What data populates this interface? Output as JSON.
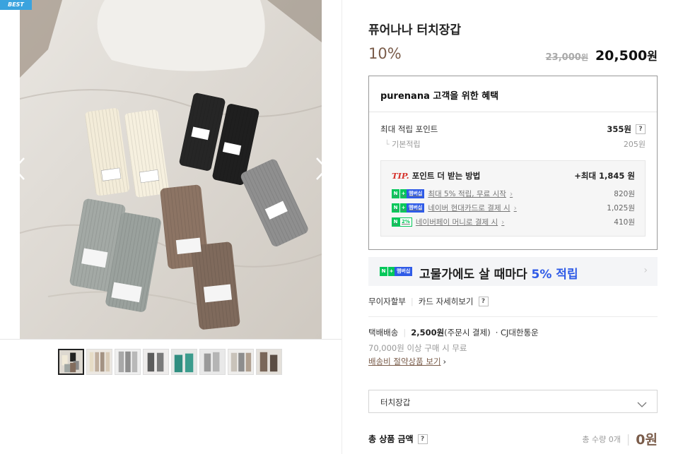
{
  "gallery": {
    "badge": "BEST",
    "thumb_count": 8
  },
  "product": {
    "title": "퓨어나나 터치장갑",
    "discount": "10%",
    "original_price": "23,000",
    "original_unit": "원",
    "sale_price": "20,500",
    "sale_unit": "원"
  },
  "benefits": {
    "title": "purenana 고객을 위한 혜택",
    "max_points_label": "최대 적립 포인트",
    "max_points_value": "355원",
    "base_points_label": "기본적립",
    "base_points_value": "205원",
    "tip": {
      "tip_label": "TIP.",
      "head": "포인트 더 받는 방법",
      "max": "+최대 1,845 원",
      "rows": [
        {
          "badge_n": "N",
          "badge_plus": "+",
          "badge_mem": "멤버십",
          "label": "최대 5% 적립, 무료 시작",
          "value": "820원"
        },
        {
          "badge_n": "N",
          "badge_plus": "+",
          "badge_mem": "멤버십",
          "label": "네이버 현대카드로 결제 시",
          "value": "1,025원"
        },
        {
          "badge_n": "N",
          "badge_pct": "2%",
          "label": "네이버페이 머니로 결제 시",
          "value": "410원"
        }
      ]
    }
  },
  "promo": {
    "badge_n": "N",
    "badge_plus": "+",
    "badge_mem": "멤버십",
    "text_before": "고물가에도 살 때마다",
    "text_highlight": "5% 적립"
  },
  "payment": {
    "installment": "무이자할부",
    "card_detail": "카드 자세히보기"
  },
  "shipping": {
    "method": "택배배송",
    "fee": "2,500원",
    "fee_note": "(주문시 결제)",
    "carrier": "· CJ대한통운",
    "free_condition": "70,000원 이상 구매 시 무료",
    "saving_link": "배송비 절약상품 보기"
  },
  "option": {
    "label": "터치장갑"
  },
  "total": {
    "label": "총 상품 금액",
    "qty_label": "총 수량 0개",
    "amount": "0원"
  },
  "help_mark": "?"
}
